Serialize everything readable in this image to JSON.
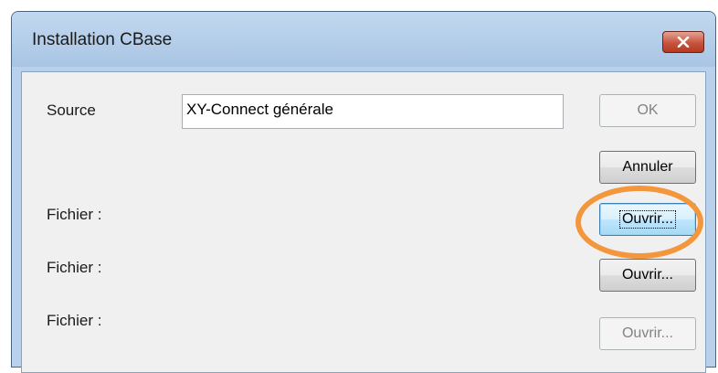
{
  "window": {
    "title": "Installation CBase",
    "close_icon": "close-x-icon"
  },
  "form": {
    "source_label": "Source",
    "source_value": "XY-Connect générale",
    "file_rows": [
      {
        "label": "Fichier :",
        "button": "Ouvrir..."
      },
      {
        "label": "Fichier :",
        "button": "Ouvrir..."
      },
      {
        "label": "Fichier :",
        "button": "Ouvrir..."
      }
    ]
  },
  "buttons": {
    "ok": "OK",
    "cancel": "Annuler"
  },
  "annotation": {
    "highlight_color": "#f3963c"
  }
}
